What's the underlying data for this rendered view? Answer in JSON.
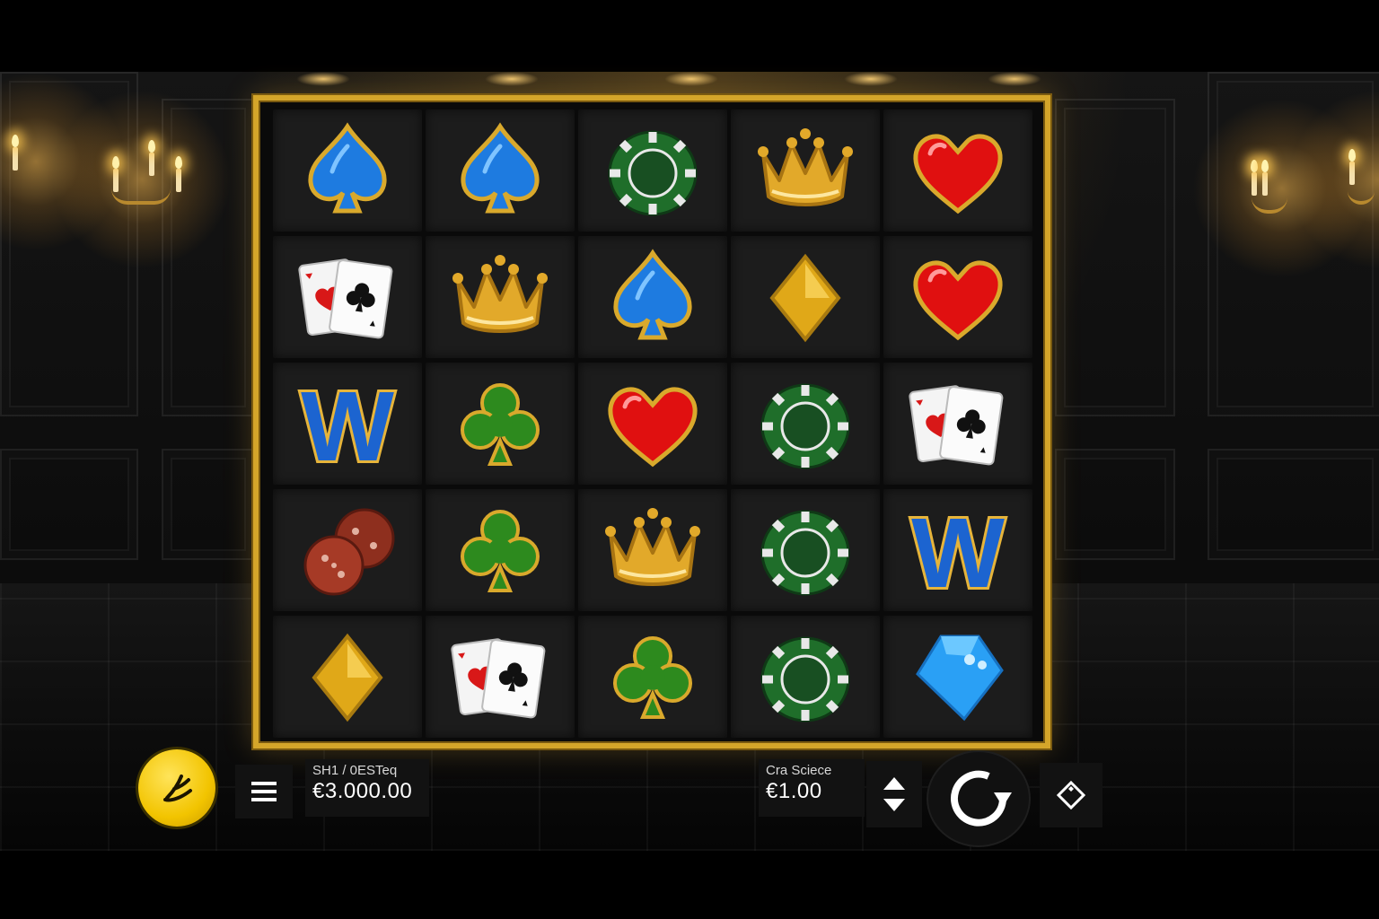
{
  "game": {
    "grid": [
      [
        "blue-spade",
        "blue-spade",
        "green-chip",
        "gold-crown",
        "red-heart"
      ],
      [
        "playing-cards",
        "gold-crown",
        "blue-spade",
        "gold-diamond",
        "red-heart"
      ],
      [
        "wild-w",
        "green-club",
        "red-heart",
        "green-chip",
        "playing-cards"
      ],
      [
        "dice",
        "green-club",
        "gold-crown",
        "green-chip",
        "wild-w"
      ],
      [
        "gold-diamond",
        "playing-cards",
        "green-club",
        "green-chip",
        "blue-gem"
      ]
    ],
    "wild_letter": "W"
  },
  "hud": {
    "balance": {
      "label": "SH1 / 0ESTeq",
      "value": "€3.000.00"
    },
    "bet": {
      "label": "Cra Sciece",
      "value": "€1.00"
    }
  },
  "icons": {
    "logo": "provider-logo-icon",
    "menu": "hamburger-menu-icon",
    "bet": "up-down-arrows-icon",
    "spin": "spin-arrow-icon",
    "autoplay": "autoplay-diamond-icon"
  },
  "colors": {
    "frame_gold": "#d4a52a",
    "logo_yellow": "#f2c400",
    "cell_bg": "#1c1c1c",
    "spade_blue": "#1e7be0",
    "heart_red": "#e01010",
    "club_green": "#2d8a1e",
    "chip_green": "#1f6e2a",
    "gem_blue": "#2aa0f5"
  }
}
